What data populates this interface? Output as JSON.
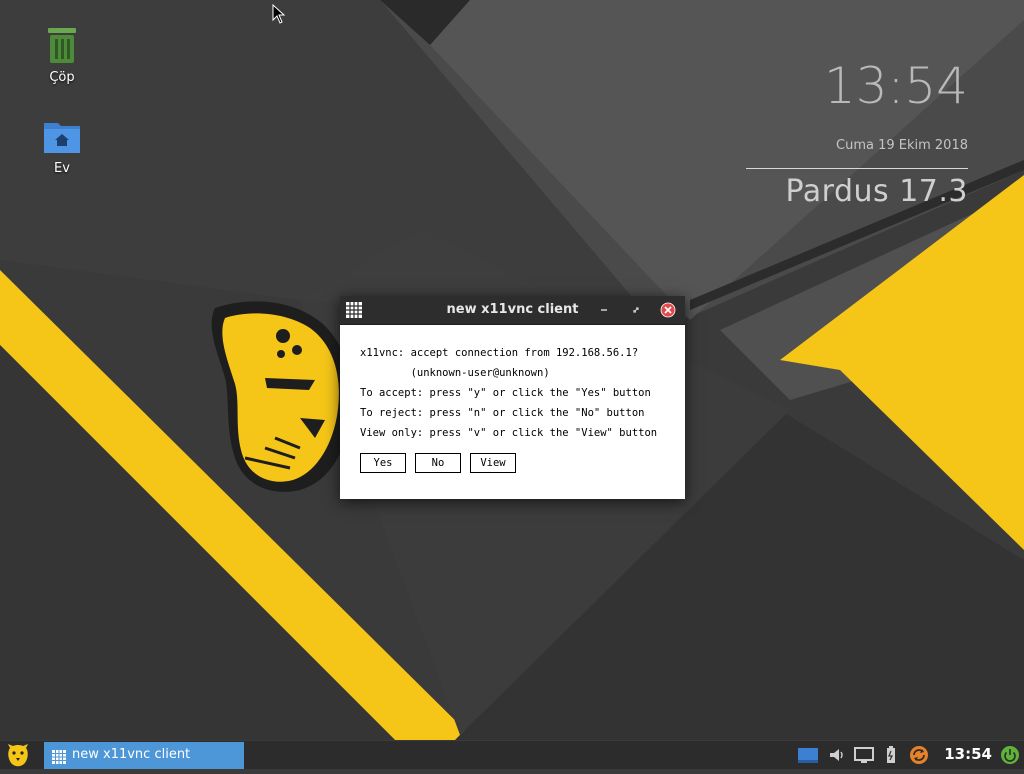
{
  "desktop": {
    "icons": [
      {
        "label": "Çöp",
        "icon": "trash-icon"
      },
      {
        "label": "Ev",
        "icon": "home-folder-icon"
      }
    ],
    "clock_widget": {
      "time": "13:54",
      "date": "Cuma 19 Ekim 2018",
      "os_version": "Pardus 17.3"
    }
  },
  "dialog": {
    "title": "new x11vnc client",
    "lines": [
      "x11vnc: accept connection from 192.168.56.1?",
      "        (unknown-user@unknown)",
      "To accept: press \"y\" or click the \"Yes\" button",
      "To reject: press \"n\" or click the \"No\" button",
      "View only: press \"v\" or click the \"View\" button"
    ],
    "buttons": {
      "yes": "Yes",
      "no": "No",
      "view": "View"
    }
  },
  "taskbar": {
    "task_title": "new x11vnc client",
    "time": "13:54",
    "tray_icons": [
      "display-icon",
      "volume-icon",
      "monitor-icon",
      "battery-icon",
      "update-icon",
      "power-icon"
    ]
  },
  "colors": {
    "accent_yellow": "#f5c518",
    "taskbar_active": "#4d97d8",
    "close_red": "#e04a4a",
    "desktop_dark": "#3a3a3a"
  }
}
